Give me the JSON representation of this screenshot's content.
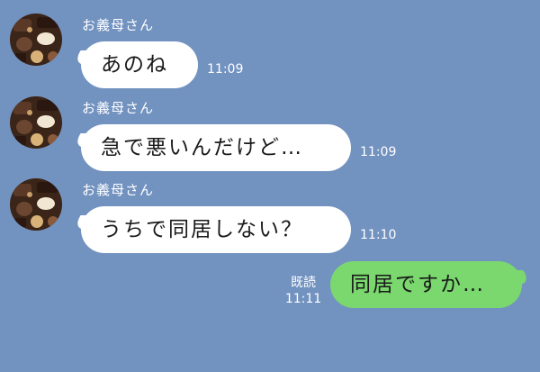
{
  "messages": [
    {
      "sender": "お義母さん",
      "text": "あのね",
      "time": "11:09"
    },
    {
      "sender": "お義母さん",
      "text": "急で悪いんだけど…",
      "time": "11:09"
    },
    {
      "sender": "お義母さん",
      "text": "うちで同居しない？",
      "time": "11:10"
    }
  ],
  "reply": {
    "text": "同居ですか…",
    "read_label": "既読",
    "time": "11:11"
  },
  "colors": {
    "background": "#7292c0",
    "incoming_bubble": "#ffffff",
    "outgoing_bubble": "#7ad86e"
  },
  "icons": {
    "avatar": "chocolate-assortment-avatar"
  }
}
